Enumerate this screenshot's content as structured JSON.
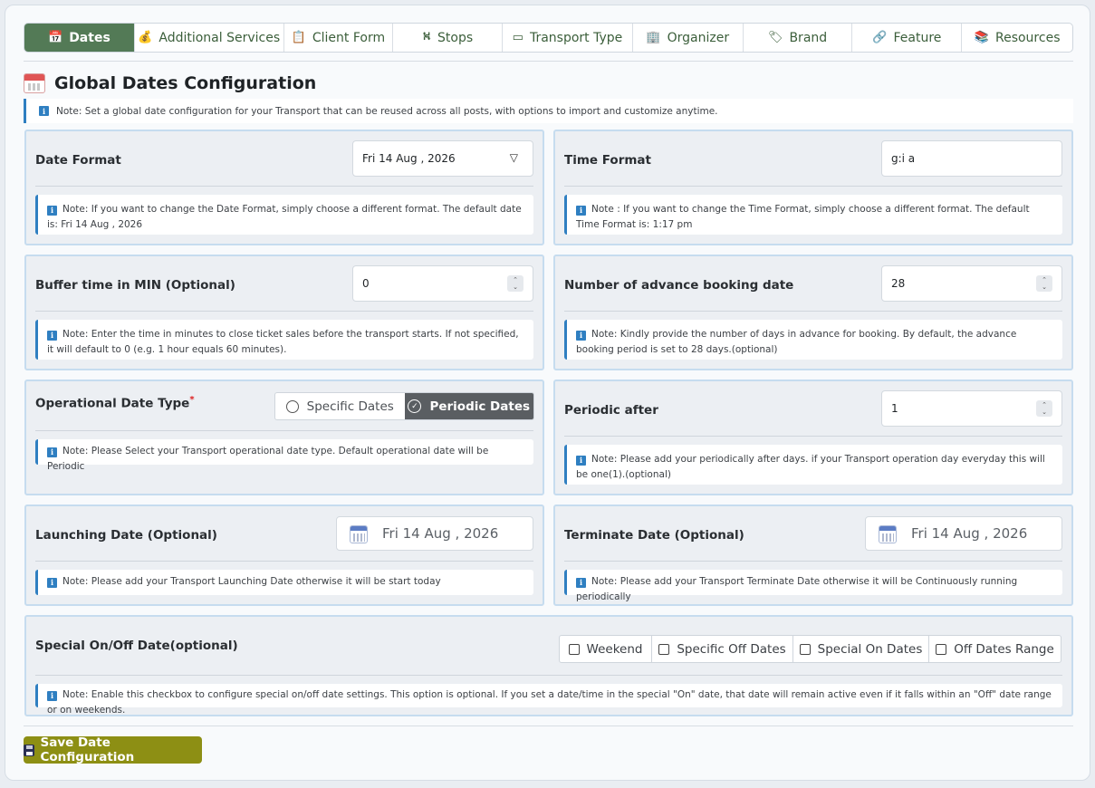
{
  "tabs": [
    {
      "label": "Dates",
      "icon": "📅"
    },
    {
      "label": "Additional Services",
      "icon": "💰"
    },
    {
      "label": "Client Form",
      "icon": "📋"
    },
    {
      "label": "Stops",
      "icon": "⛕"
    },
    {
      "label": "Transport Type",
      "icon": "▭"
    },
    {
      "label": "Organizer",
      "icon": "🏢"
    },
    {
      "label": "Brand",
      "icon": "🏷"
    },
    {
      "label": "Feature",
      "icon": "🔗"
    },
    {
      "label": "Resources",
      "icon": "📚"
    }
  ],
  "page": {
    "title": "Global Dates Configuration",
    "note": "Note: Set a global date configuration for your Transport that can be reused across all posts, with options to import and customize anytime."
  },
  "date_format": {
    "label": "Date Format",
    "value": "Fri 14 Aug , 2026",
    "note": "Note: If you want to change the Date Format, simply choose a different format. The default date is: Fri 14 Aug , 2026"
  },
  "time_format": {
    "label": "Time Format",
    "value": "g:i a",
    "note": "Note : If you want to change the Time Format, simply choose a different format. The default Time Format is: 1:17 pm"
  },
  "buffer_time": {
    "label": "Buffer time in MIN (Optional)",
    "value": "0",
    "note": "Note: Enter the time in minutes to close ticket sales before the transport starts. If not specified, it will default to 0 (e.g. 1 hour equals 60 minutes)."
  },
  "advance_booking": {
    "label": "Number of advance booking date",
    "value": "28",
    "note": "Note: Kindly provide the number of days in advance for booking. By default, the advance booking period is set to 28 days.(optional)"
  },
  "operational_type": {
    "label": "Operational Date Type",
    "required_mark": "*",
    "options": [
      "Specific Dates",
      "Periodic Dates"
    ],
    "selected": "Periodic Dates",
    "note": "Note: Please Select your Transport operational date type. Default operational date will be Periodic"
  },
  "periodic_after": {
    "label": "Periodic after",
    "value": "1",
    "note": "Note: Please add your periodically after days. if your Transport operation day everyday this will be one(1).(optional)"
  },
  "launching_date": {
    "label": "Launching Date (Optional)",
    "value": "Fri 14 Aug , 2026",
    "note": "Note: Please add your Transport Launching Date otherwise it will be start today"
  },
  "terminate_date": {
    "label": "Terminate Date (Optional)",
    "value": "Fri 14 Aug , 2026",
    "note": "Note: Please add your Transport Terminate Date otherwise it will be Continuously running periodically"
  },
  "special_dates": {
    "label": "Special On/Off Date(optional)",
    "options": [
      "Weekend",
      "Specific Off Dates",
      "Special On Dates",
      "Off Dates Range"
    ],
    "note": "Note: Enable this checkbox to configure special on/off date settings. This option is optional. If you set a date/time in the special \"On\" date, that date will remain active even if it falls within an \"Off\" date range or on weekends."
  },
  "save_button": {
    "label": "Save Date Configuration"
  },
  "info_glyph": "i",
  "colors": {
    "active_tab": "#537a56",
    "save_button": "#8d8f14",
    "note_accent": "#2f7fc1",
    "toggle_on": "#5a5e62"
  }
}
